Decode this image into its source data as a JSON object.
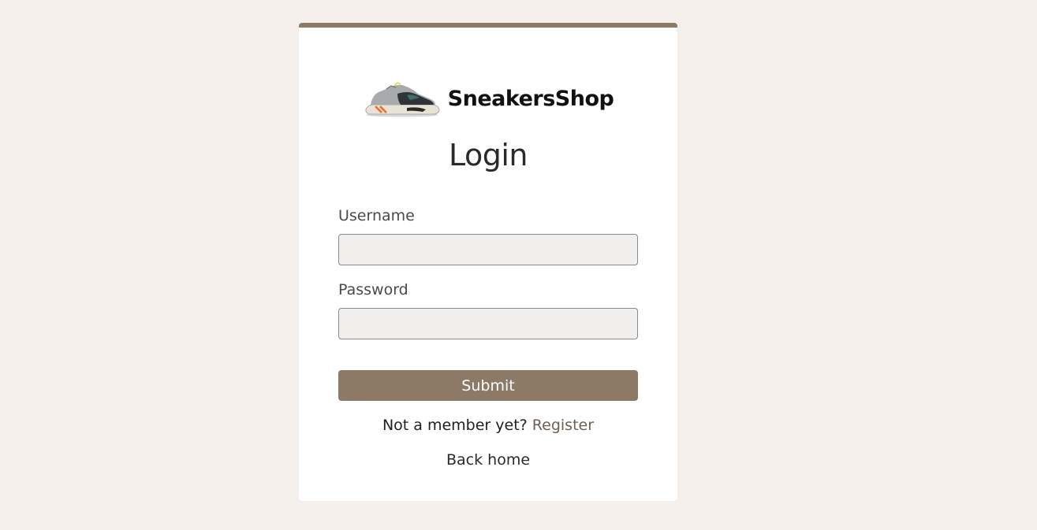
{
  "brand": {
    "name": "SneakersShop",
    "logo_icon": "sneaker-icon"
  },
  "page": {
    "title": "Login"
  },
  "form": {
    "username_label": "Username",
    "username_value": "",
    "password_label": "Password",
    "password_value": "",
    "submit_label": "Submit"
  },
  "footer": {
    "register_prompt": "Not a member yet?",
    "register_link": "Register",
    "back_home": "Back home"
  },
  "colors": {
    "background": "#f4efeb",
    "accent": "#8d7a66",
    "input_bg": "#f0efed",
    "link": "#6e5f52"
  }
}
